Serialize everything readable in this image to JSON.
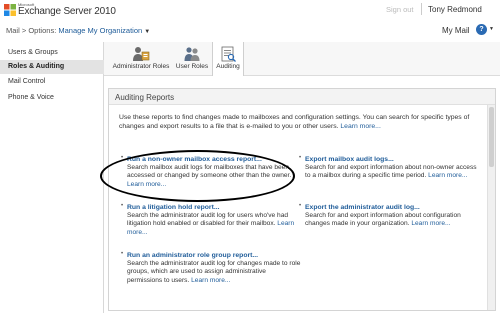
{
  "brand": {
    "company": "Microsoft",
    "product": "Exchange Server 2010"
  },
  "topbar": {
    "sign_out": "Sign out",
    "user": "Tony Redmond"
  },
  "breadcrumb": {
    "mail": "Mail",
    "sep": ">",
    "options": "Options:",
    "scope": "Manage My Organization",
    "dropdown": "▼"
  },
  "header_right": {
    "my_mail": "My Mail",
    "help": "?",
    "help_dropdown": "▼"
  },
  "sidebar": {
    "items": [
      {
        "label": "Users & Groups"
      },
      {
        "label": "Roles & Auditing"
      },
      {
        "label": "Mail Control"
      },
      {
        "label": "Phone & Voice"
      }
    ]
  },
  "toolbar": {
    "tools": [
      {
        "label": "Administrator Roles",
        "icon": "admin-roles-icon"
      },
      {
        "label": "User Roles",
        "icon": "user-roles-icon"
      },
      {
        "label": "Auditing",
        "icon": "auditing-icon"
      }
    ]
  },
  "panel": {
    "title": "Auditing Reports",
    "intro": "Use these reports to find changes made to mailboxes and configuration settings. You can search for specific types of changes and export results to a file that is e-mailed to you or other users.",
    "learn_more": "Learn more...",
    "left": [
      {
        "title": "Run a non-owner mailbox access report...",
        "desc": "Search mailbox audit logs for mailboxes that have been accessed or changed by someone other than the owner.",
        "more": "Learn more..."
      },
      {
        "title": "Run a litigation hold report...",
        "desc": "Search the administrator audit log for users who've had litigation hold enabled or disabled for their mailbox.",
        "more": "Learn more..."
      },
      {
        "title": "Run an administrator role group report...",
        "desc": "Search the administrator audit log for changes made to role groups, which are used to assign administrative permissions to users.",
        "more": "Learn more..."
      }
    ],
    "right": [
      {
        "title": "Export mailbox audit logs...",
        "desc": "Search for and export information about non-owner access to a mailbox during a specific time period.",
        "more": "Learn more..."
      },
      {
        "title": "Export the administrator audit log...",
        "desc": "Search for and export information about configuration changes made in your organization.",
        "more": "Learn more..."
      }
    ]
  },
  "colors": {
    "link": "#1f5c99",
    "active_sidebar": "#e3e3e3"
  }
}
